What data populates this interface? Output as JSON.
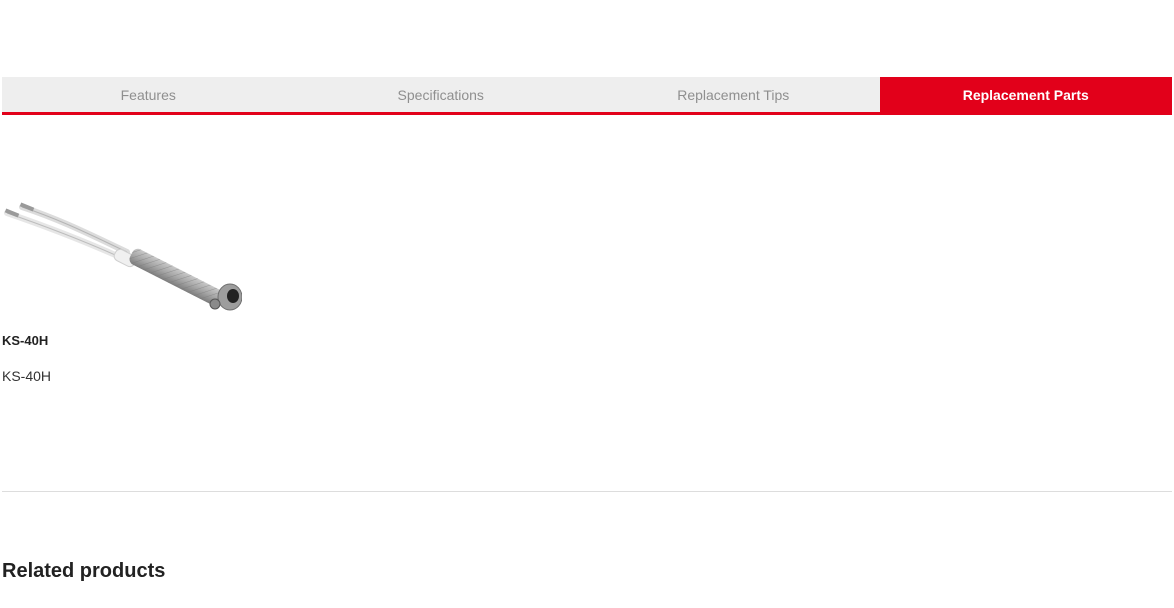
{
  "tabs": [
    {
      "label": "Features",
      "active": false
    },
    {
      "label": "Specifications",
      "active": false
    },
    {
      "label": "Replacement Tips",
      "active": false
    },
    {
      "label": "Replacement Parts",
      "active": true
    }
  ],
  "colors": {
    "accent": "#e2001a",
    "tab_bg": "#eeeeee",
    "tab_text": "#8f8f8f"
  },
  "product": {
    "title": "KS-40H",
    "sku": "KS-40H",
    "image_icon": "heating-element-image"
  },
  "related": {
    "heading": "Related products"
  }
}
